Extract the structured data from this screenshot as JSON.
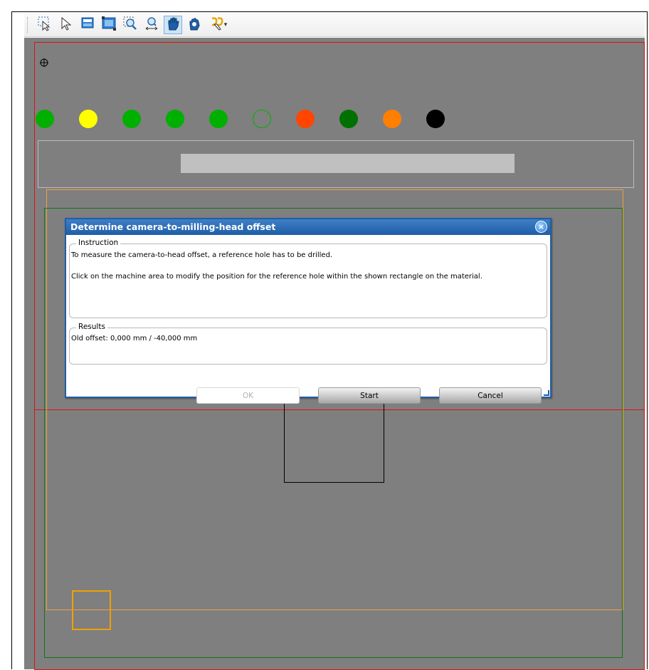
{
  "toolbar": {
    "icons": [
      "rect-select-icon",
      "pointer-select-icon",
      "zoom-fit-icon",
      "zoom-page-icon",
      "zoom-window-icon",
      "zoom-width-icon",
      "pan-hand-icon",
      "pan-grab-icon",
      "scissors-tool-icon"
    ]
  },
  "colors": {
    "canvas_bg": "#7f7f7f",
    "machine_area": "#e01010",
    "material_area": "#f0a040",
    "work_area": "#117711",
    "indicator_dots": [
      "#00b000",
      "#ffff00",
      "#00b000",
      "#00b000",
      "#00b000",
      "outline-green",
      "#ff4500",
      "#007000",
      "#ff8000",
      "#000000"
    ]
  },
  "dialog": {
    "title": "Determine camera-to-milling-head offset",
    "close_label": "×",
    "instruction_legend": "Instruction",
    "instruction_line1": "To measure the camera-to-head offset, a reference hole has to be drilled.",
    "instruction_line2": "Click on the machine area to modify the position for the reference hole within the shown rectangle on the material.",
    "results_legend": "Results",
    "results_text": "Old offset: 0,000 mm / -40,000 mm",
    "ok_label": "OK",
    "start_label": "Start",
    "cancel_label": "Cancel"
  }
}
